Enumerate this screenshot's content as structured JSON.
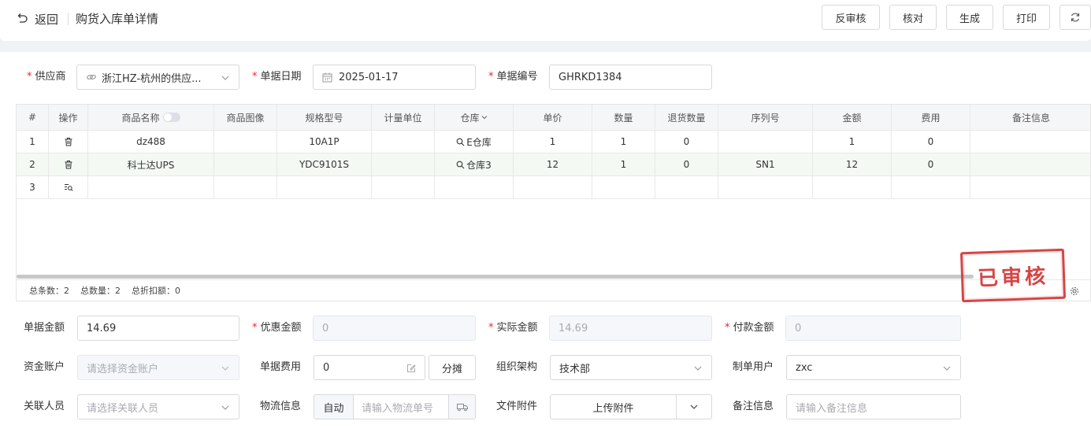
{
  "header": {
    "back_label": "返回",
    "title": "购货入库单详情",
    "buttons": [
      "反审核",
      "核对",
      "生成",
      "打印"
    ]
  },
  "form_top": {
    "supplier_label": "供应商",
    "supplier_value": "浙江HZ-杭州的供应...",
    "date_label": "单据日期",
    "date_value": "2025-01-17",
    "number_label": "单据编号",
    "number_value": "GHRKD1384"
  },
  "table": {
    "headers": [
      "#",
      "操作",
      "商品名称",
      "商品图像",
      "规格型号",
      "计量单位",
      "仓库",
      "单价",
      "数量",
      "退货数量",
      "序列号",
      "金额",
      "费用",
      "备注信息"
    ],
    "rows": [
      {
        "no": "1",
        "name": "dz488",
        "spec": "10A1P",
        "warehouse": "E仓库",
        "price": "1",
        "qty": "1",
        "return_qty": "0",
        "serial": "",
        "amount": "1",
        "fee": "0"
      },
      {
        "no": "2",
        "name": "科士达UPS",
        "spec": "YDC9101S",
        "warehouse": "仓库3",
        "price": "12",
        "qty": "1",
        "return_qty": "0",
        "serial": "SN1",
        "amount": "12",
        "fee": "0"
      }
    ],
    "new_row_no": "3",
    "footer": {
      "total_count": "总条数：2",
      "total_qty": "总数量：2",
      "total_discount": "总折扣额：0"
    },
    "stamp": "已审核"
  },
  "form_bottom": {
    "bill_amount_label": "单据金额",
    "bill_amount_value": "14.69",
    "discount_label": "优惠金额",
    "discount_value": "0",
    "actual_label": "实际金额",
    "actual_value": "14.69",
    "paid_label": "付款金额",
    "paid_value": "0",
    "account_label": "资金账户",
    "account_placeholder": "请选择资金账户",
    "fee_label": "单据费用",
    "fee_value": "0",
    "split_label": "分摊",
    "org_label": "组织架构",
    "org_value": "技术部",
    "maker_label": "制单用户",
    "maker_value": "zxc",
    "person_label": "关联人员",
    "person_placeholder": "请选择关联人员",
    "logistics_label": "物流信息",
    "logistics_mode": "自动",
    "logistics_placeholder": "请输入物流单号",
    "file_label": "文件附件",
    "upload_label": "上传附件",
    "remark_label": "备注信息",
    "remark_placeholder": "请输入备注信息"
  },
  "colors": {
    "required": "#f5222d",
    "stamp": "#d64545",
    "row_highlight": "#f4f9f4"
  },
  "icons": [
    "undo-icon",
    "link-icon",
    "calendar-icon",
    "chevron-down-icon",
    "trash-icon",
    "search-list-icon",
    "search-icon",
    "settings-icon",
    "refresh-icon",
    "edit-icon",
    "truck-icon"
  ]
}
